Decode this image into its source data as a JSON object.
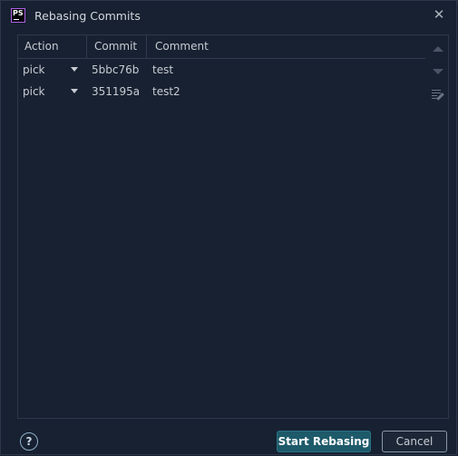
{
  "window": {
    "title": "Rebasing Commits",
    "app_icon": "phpstorm-icon",
    "app_icon_text": "PS"
  },
  "table": {
    "columns": [
      "Action",
      "Commit",
      "Comment"
    ],
    "rows": [
      {
        "action": "pick",
        "commit": "5bbc76b",
        "comment": "test"
      },
      {
        "action": "pick",
        "commit": "351195a",
        "comment": "test2"
      }
    ]
  },
  "toolbar": {
    "icons": [
      "move-up-icon",
      "move-down-icon",
      "reword-icon"
    ]
  },
  "footer": {
    "help_label": "?",
    "start_label": "Start Rebasing",
    "cancel_label": "Cancel"
  },
  "colors": {
    "background": "#172131",
    "primary_button": "#1d5a6a",
    "app_icon_accent": "#ad62e9"
  }
}
